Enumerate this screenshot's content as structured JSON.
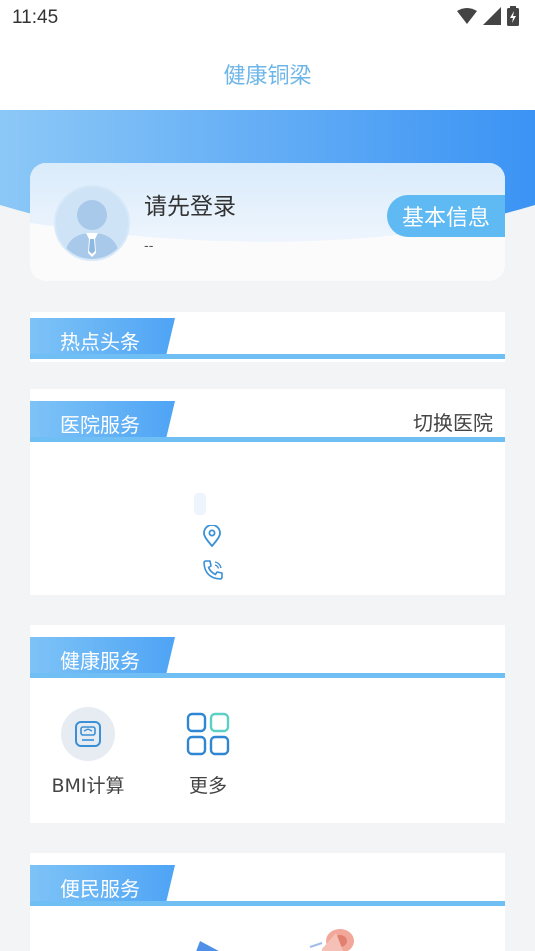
{
  "status_bar": {
    "time": "11:45"
  },
  "app": {
    "title": "健康铜梁"
  },
  "user_card": {
    "login_prompt": "请先登录",
    "subtitle": "--",
    "basic_info_label": "基本信息"
  },
  "sections": {
    "hot_news": {
      "title": "热点头条"
    },
    "hospital_service": {
      "title": "医院服务",
      "switch_label": "切换医院"
    },
    "health_service": {
      "title": "健康服务",
      "items": [
        {
          "label": "BMI计算",
          "icon": "scale-icon"
        },
        {
          "label": "更多",
          "icon": "grid-icon"
        }
      ]
    },
    "convenience_service": {
      "title": "便民服务"
    }
  },
  "colors": {
    "accent": "#6fbff5",
    "hero_start": "#89c6f6",
    "hero_end": "#3d97f5",
    "title": "#6fb6e8"
  }
}
